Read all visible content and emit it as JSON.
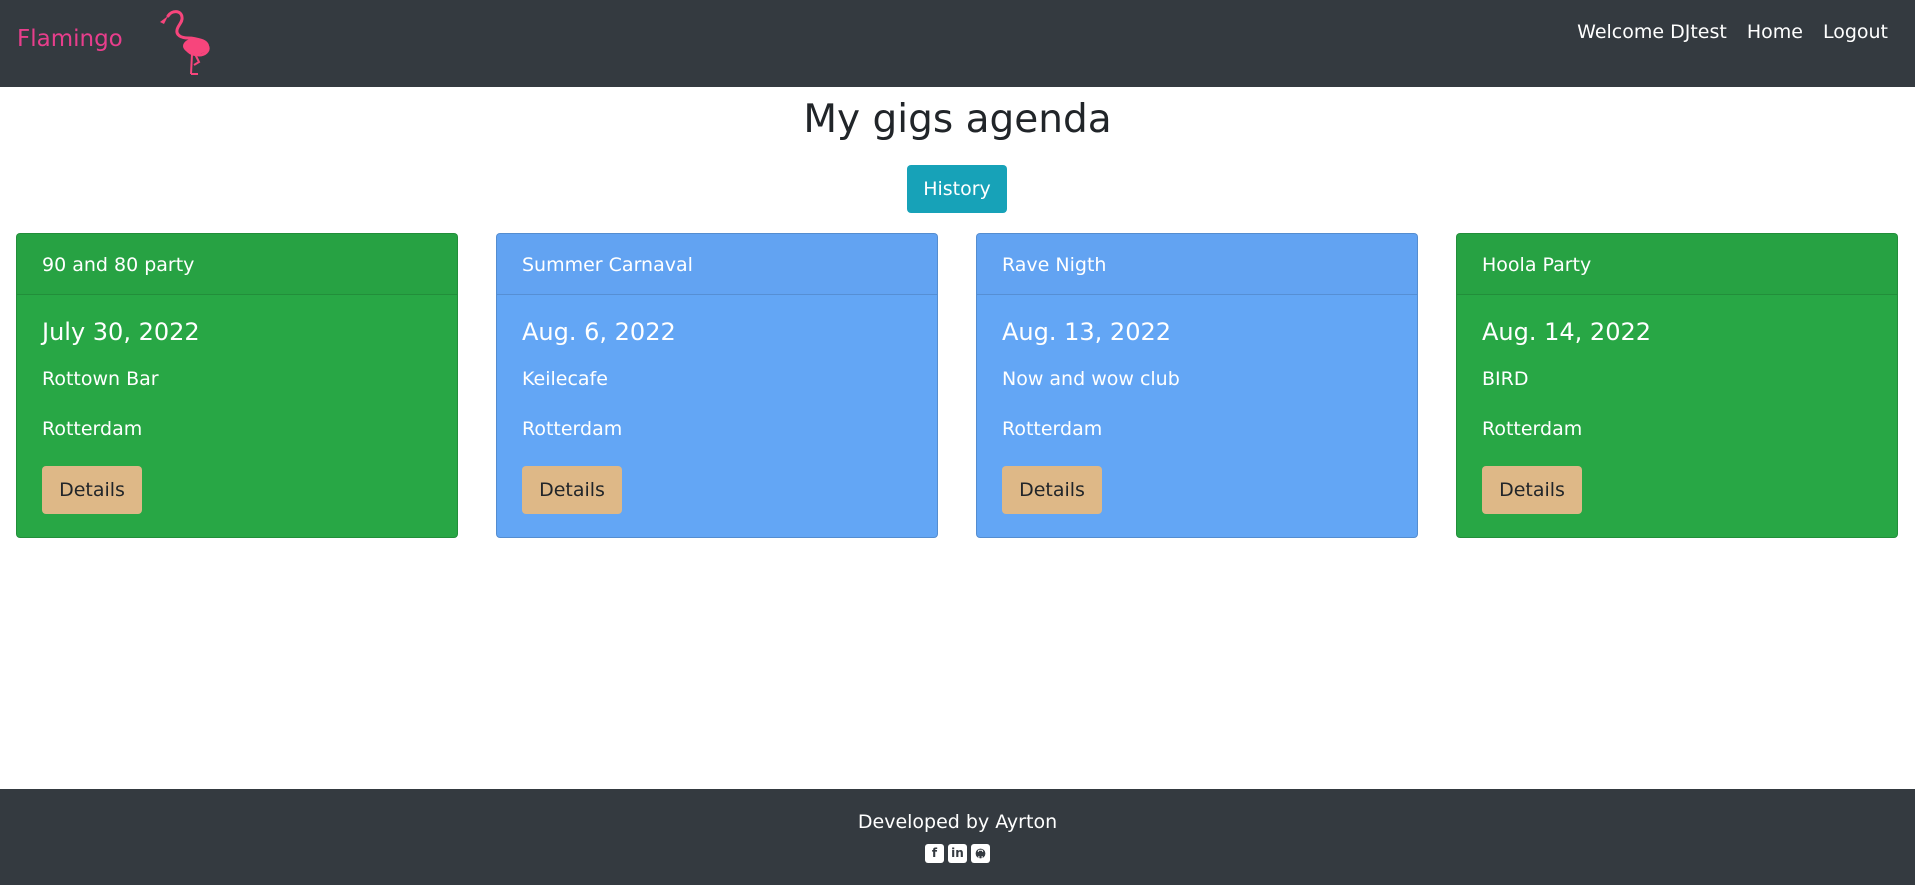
{
  "navbar": {
    "brand": "Flamingo",
    "links": {
      "welcome": "Welcome DJtest",
      "home": "Home",
      "logout": "Logout"
    }
  },
  "main": {
    "title": "My gigs agenda",
    "history_label": "History",
    "gigs": [
      {
        "name": "90 and 80 party",
        "date": "July 30, 2022",
        "venue": "Rottown Bar",
        "city": "Rotterdam",
        "details_label": "Details",
        "color": "#28a745"
      },
      {
        "name": "Summer Carnaval",
        "date": "Aug. 6, 2022",
        "venue": "Keilecafe",
        "city": "Rotterdam",
        "details_label": "Details",
        "color": "#63a6f5"
      },
      {
        "name": "Rave Nigth",
        "date": "Aug. 13, 2022",
        "venue": "Now and wow club",
        "city": "Rotterdam",
        "details_label": "Details",
        "color": "#63a6f5"
      },
      {
        "name": "Hoola Party",
        "date": "Aug. 14, 2022",
        "venue": "BIRD",
        "city": "Rotterdam",
        "details_label": "Details",
        "color": "#28a745"
      }
    ]
  },
  "footer": {
    "text": "Developed by Ayrton",
    "icons": [
      "facebook-icon",
      "linkedin-icon",
      "github-icon"
    ]
  },
  "colors": {
    "navbar_bg": "#343a40",
    "brand": "#e83e8c",
    "history_button": "#17a2b8",
    "details_button": "#deb887"
  }
}
